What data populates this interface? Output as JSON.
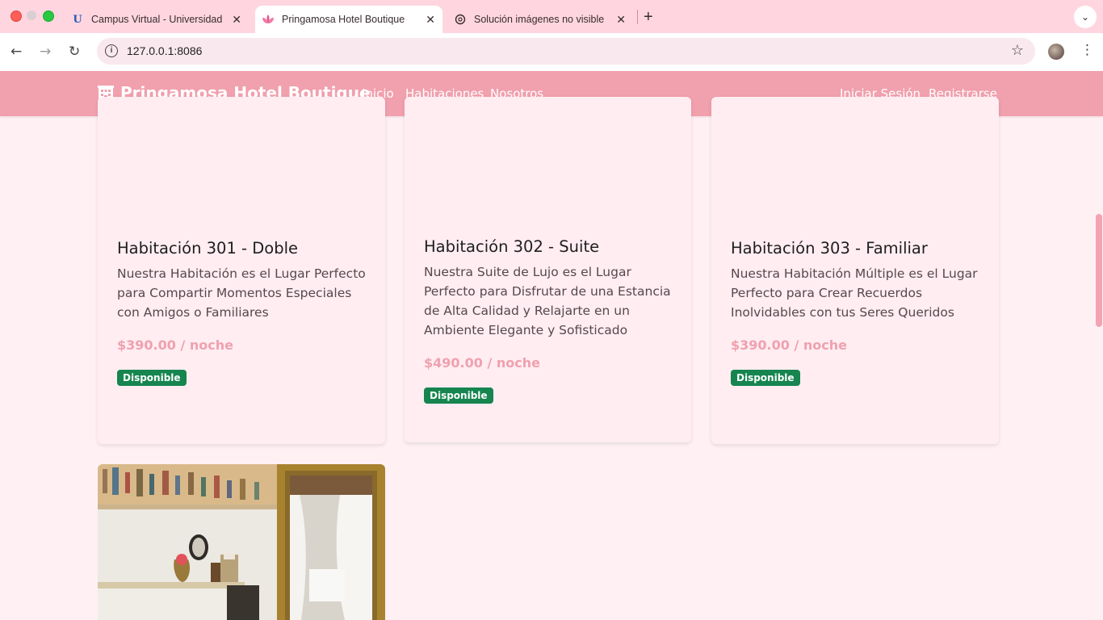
{
  "browser": {
    "tabs": [
      {
        "title": "Campus Virtual - Universidad",
        "favicon": "university-icon"
      },
      {
        "title": "Pringamosa Hotel Boutique",
        "favicon": "lotus-icon",
        "active": true
      },
      {
        "title": "Solución imágenes no visible",
        "favicon": "openai-icon"
      }
    ],
    "url": "127.0.0.1:8086"
  },
  "navbar": {
    "brand": "Pringamosa Hotel Boutique",
    "brand_icon": "hotel-icon",
    "links": [
      "Inicio",
      "Habitaciones",
      "Nosotros"
    ],
    "auth": [
      "Iniciar Sesión",
      "Registrarse"
    ]
  },
  "rooms": [
    {
      "title": "Habitación 301 - Doble",
      "description": "Nuestra Habitación es el Lugar Perfecto para Compartir Momentos Especiales con Amigos o Familiares",
      "price": "$390.00 / noche",
      "status": "Disponible"
    },
    {
      "title": "Habitación 302 - Suite",
      "description": "Nuestra Suite de Lujo es el Lugar Perfecto para Disfrutar de una Estancia de Alta Calidad y Relajarte en un Ambiente Elegante y Sofisticado",
      "price": "$490.00 / noche",
      "status": "Disponible"
    },
    {
      "title": "Habitación 303 - Familiar",
      "description": "Nuestra Habitación Múltiple es el Lugar Perfecto para Crear Recuerdos Inolvidables con tus Seres Queridos",
      "price": "$390.00 / noche",
      "status": "Disponible"
    }
  ],
  "colors": {
    "navbar": "#f1a0ad",
    "price": "#efa1ae",
    "badge": "#16854f",
    "page_bg": "#fff0f4"
  }
}
